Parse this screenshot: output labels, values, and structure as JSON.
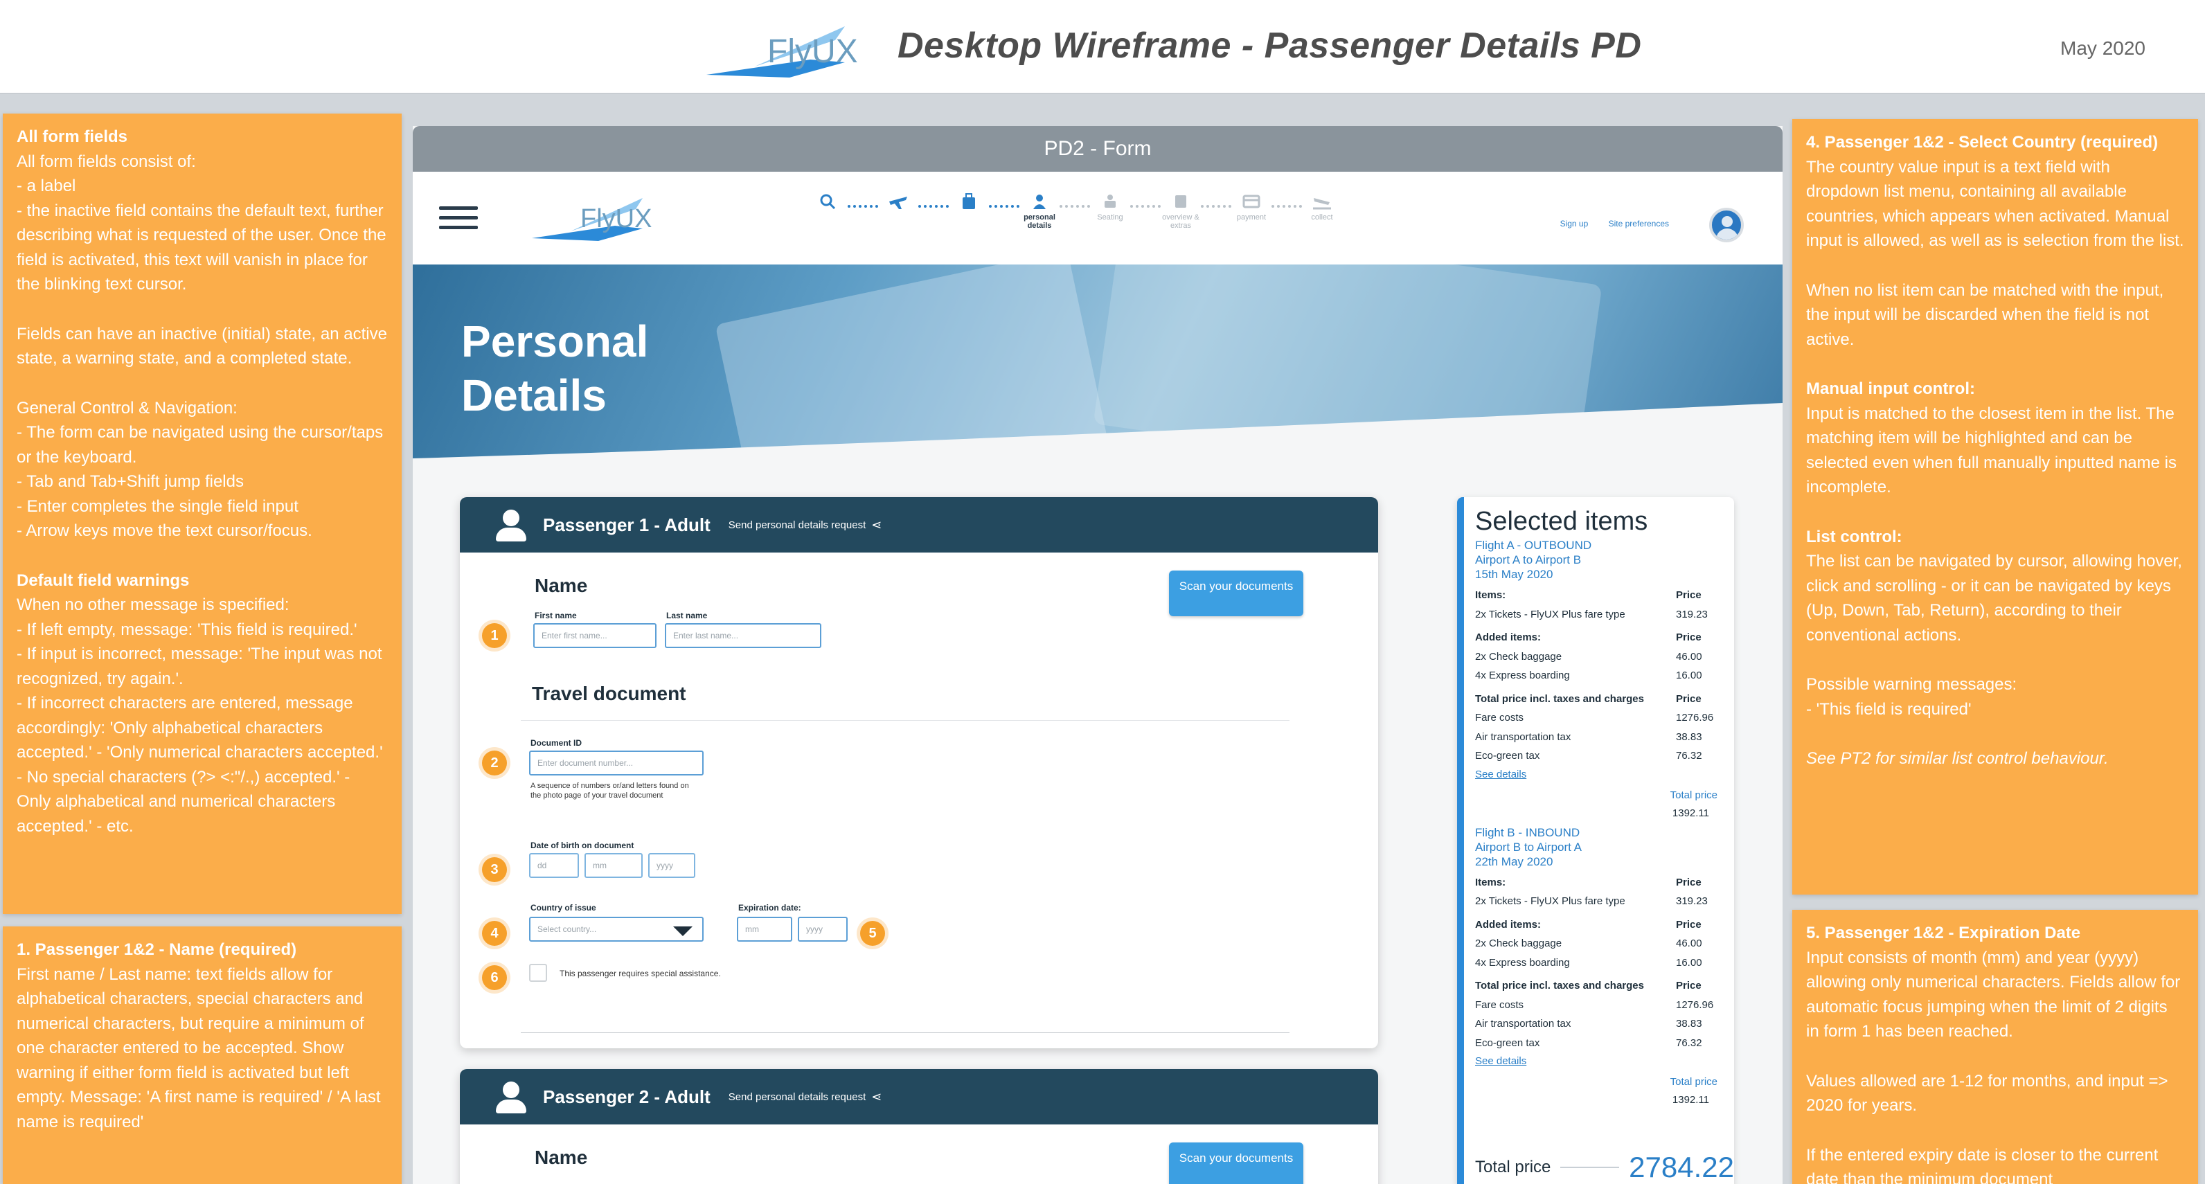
{
  "header": {
    "brand": "FlyUX",
    "title": "Desktop Wireframe - Passenger Details PD",
    "date": "May 2020"
  },
  "notes": {
    "all_fields": {
      "heading": "All form fields",
      "p1": "All form fields consist of:\n- a label\n- the inactive field contains the default text, further describing what is requested of the user. Once the field is activated, this text will vanish in place for the blinking text cursor.",
      "p2": "Fields can have an inactive (initial) state, an active state, a warning state, and a completed state.",
      "p3": "General Control & Navigation:\n- The form can be navigated using the cursor/taps or the keyboard.\n- Tab and Tab+Shift jump fields\n- Enter completes the single field input\n- Arrow keys move the text cursor/focus.",
      "heading2": "Default field warnings",
      "p4": "When no other message is specified:\n- If left empty, message: 'This field is required.'\n- If input is incorrect, message: 'The input was not recognized, try again.'.\n- If incorrect characters are entered, message accordingly: 'Only alphabetical characters accepted.' - 'Only numerical characters accepted.' - No special characters (?> <:\"/.,) accepted.' - Only alphabetical and numerical characters accepted.' - etc."
    },
    "passenger_name": {
      "heading": "1. Passenger 1&2 - Name (required)",
      "body": "First name / Last name: text fields allow for alphabetical characters, special characters and numerical characters, but require a minimum of one character entered to be accepted. Show warning if either form field is activated but left empty. Message: 'A first name is required' / 'A last name is required'"
    },
    "select_country": {
      "heading": "4. Passenger 1&2 - Select Country (required)",
      "p1": "The country value input is a text field with dropdown list menu, containing all available countries, which appears when activated. Manual input is allowed, as well as is selection from the list.",
      "p2": "When no list item can be matched with the input, the input will be discarded when the field is not active.",
      "h2": "Manual input control:",
      "p3": "Input is matched to the closest item in the list. The matching item will be highlighted and can be selected even when full manually inputted name is incomplete.",
      "h3": "List control:",
      "p4": "The list can be navigated by cursor, allowing hover, click and scrolling - or it can be navigated by keys (Up, Down, Tab, Return), according to their conventional actions.",
      "p5": "Possible warning messages:\n- 'This field is required'",
      "p6": "See PT2 for similar list control behaviour."
    },
    "expiration": {
      "heading": "5. Passenger 1&2 - Expiration Date",
      "p1": "Input consists of month (mm) and year (yyyy) allowing only numerical characters. Fields allow for automatic focus jumping when the limit of 2 digits in form 1 has been reached.",
      "p2": "Values allowed are 1-12 for months, and input => 2020 for years.",
      "p3": "If the entered expiry date is closer to the current date than the minimum document"
    }
  },
  "frame": {
    "title": "PD2 - Form",
    "nav": {
      "logo": "FlyUX",
      "steps": [
        {
          "label": "",
          "icon": "search-icon"
        },
        {
          "label": "",
          "icon": "plane-icon"
        },
        {
          "label": "",
          "icon": "luggage-icon"
        },
        {
          "label": "personal details",
          "icon": "person-icon"
        },
        {
          "label": "Seating",
          "icon": "seat-icon"
        },
        {
          "label": "overview & extras",
          "icon": "list-icon"
        },
        {
          "label": "payment",
          "icon": "card-icon"
        },
        {
          "label": "collect",
          "icon": "landing-icon"
        }
      ],
      "sign_up": "Sign up",
      "site_prefs": "Site preferences"
    },
    "hero_title_1": "Personal",
    "hero_title_2": "Details"
  },
  "passenger1": {
    "title": "Passenger 1 - Adult",
    "request": "Send personal details request",
    "name_heading": "Name",
    "scan": "Scan your documents",
    "first_label": "First name",
    "first_ph": "Enter first name...",
    "last_label": "Last name",
    "last_ph": "Enter last name...",
    "travel_heading": "Travel document",
    "docid_label": "Document ID",
    "docid_ph": "Enter document number...",
    "docid_hint": "A sequence of numbers or/and letters found on the photo page of your travel document",
    "dob_label": "Date of birth on document",
    "dd": "dd",
    "mm": "mm",
    "yyyy": "yyyy",
    "country_label": "Country of issue",
    "country_ph": "Select country...",
    "exp_label": "Expiration date:",
    "exp_mm": "mm",
    "exp_yyyy": "yyyy",
    "assist": "This passenger requires special assistance.",
    "badges": [
      "1",
      "2",
      "3",
      "4",
      "5",
      "6"
    ]
  },
  "passenger2": {
    "title": "Passenger 2 - Adult",
    "request": "Send personal details request",
    "name_heading": "Name",
    "scan": "Scan your documents"
  },
  "selected": {
    "title": "Selected items",
    "flights": [
      {
        "line1": "Flight A - OUTBOUND",
        "line2": "Airport A to Airport B",
        "line3": "15th May 2020",
        "items_label": "Items:",
        "price_label": "Price",
        "tickets": "2x Tickets - FlyUX Plus fare type",
        "tickets_price": "319.23",
        "added_label": "Added items:",
        "added_price_label": "Price",
        "baggage": "2x Check baggage",
        "baggage_price": "46.00",
        "boarding": "4x Express boarding",
        "boarding_price": "16.00",
        "total_label": "Total price incl. taxes and charges",
        "total_price_label": "Price",
        "fare": "Fare costs",
        "fare_price": "1276.96",
        "tax": "Air transportation tax",
        "tax_price": "38.83",
        "eco": "Eco-green tax",
        "eco_price": "76.32",
        "see": "See details",
        "sub_label": "Total price",
        "sub_value": "1392.11"
      },
      {
        "line1": "Flight B - INBOUND",
        "line2": "Airport B to Airport A",
        "line3": "22th May 2020",
        "items_label": "Items:",
        "price_label": "Price",
        "tickets": "2x Tickets - FlyUX Plus fare type",
        "tickets_price": "319.23",
        "added_label": "Added items:",
        "added_price_label": "Price",
        "baggage": "2x Check baggage",
        "baggage_price": "46.00",
        "boarding": "4x Express boarding",
        "boarding_price": "16.00",
        "total_label": "Total price incl. taxes and charges",
        "total_price_label": "Price",
        "fare": "Fare costs",
        "fare_price": "1276.96",
        "tax": "Air transportation tax",
        "tax_price": "38.83",
        "eco": "Eco-green tax",
        "eco_price": "76.32",
        "see": "See details",
        "sub_label": "Total price",
        "sub_value": "1392.11"
      }
    ],
    "total_label": "Total price",
    "total_value": "2784.22"
  },
  "colors": {
    "note_orange": "#fbad4a",
    "card_header": "#23495e",
    "accent_blue": "#2a7fc7",
    "badge_orange": "#f6a02a"
  }
}
